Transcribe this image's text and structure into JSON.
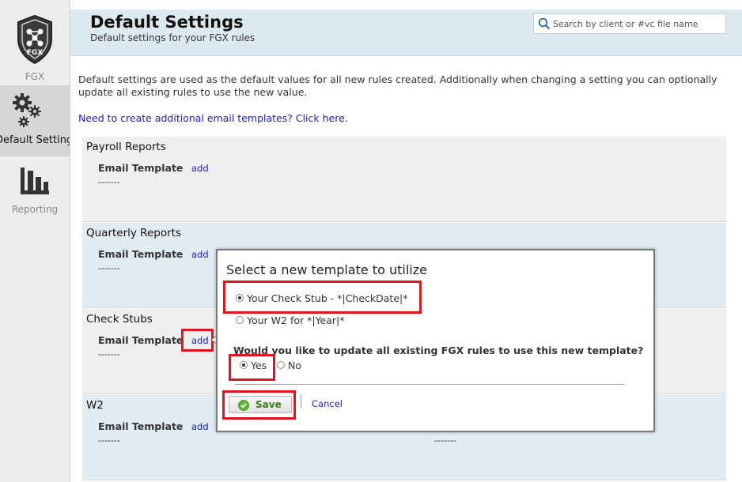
{
  "sidebar": {
    "logo_text": "FGX",
    "app_label": "FGX",
    "settings_label": "Default Settings",
    "reporting_label": "Reporting"
  },
  "header": {
    "title": "Default Settings",
    "subtitle": "Default settings for your FGX rules",
    "search_placeholder": "Search by client or #vc file name"
  },
  "main": {
    "intro": "Default settings are used as the default values for all new rules created. Additionally when changing a setting you can optionally update all existing rules to use the new value.",
    "email_templates_link": "Need to create additional email templates? Click here.",
    "sections": [
      {
        "title": "Payroll Reports",
        "field_label": "Email Template",
        "add_label": "add",
        "value": "-------"
      },
      {
        "title": "Quarterly Reports",
        "field_label": "Email Template",
        "add_label": "add",
        "value": "-------"
      },
      {
        "title": "Check Stubs",
        "field_label": "Email Template",
        "add_label": "add",
        "value": "-------"
      },
      {
        "title": "W2",
        "field_label": "Email Template",
        "add_label": "add",
        "value": "-------",
        "value2": "-------"
      }
    ]
  },
  "modal": {
    "title": "Select a new template to utilize",
    "options": [
      {
        "label": "Your Check Stub - *|CheckDate|*",
        "selected": true
      },
      {
        "label": "Your W2 for *|Year|*",
        "selected": false
      }
    ],
    "question": "Would you like to update all existing FGX rules to use this new template?",
    "answers": [
      {
        "label": "Yes",
        "selected": true
      },
      {
        "label": "No",
        "selected": false
      }
    ],
    "save_label": "Save",
    "cancel_label": "Cancel"
  },
  "colors": {
    "highlight": "#e0141e",
    "header_bg": "#dde9f1",
    "link": "#1a1acc"
  }
}
